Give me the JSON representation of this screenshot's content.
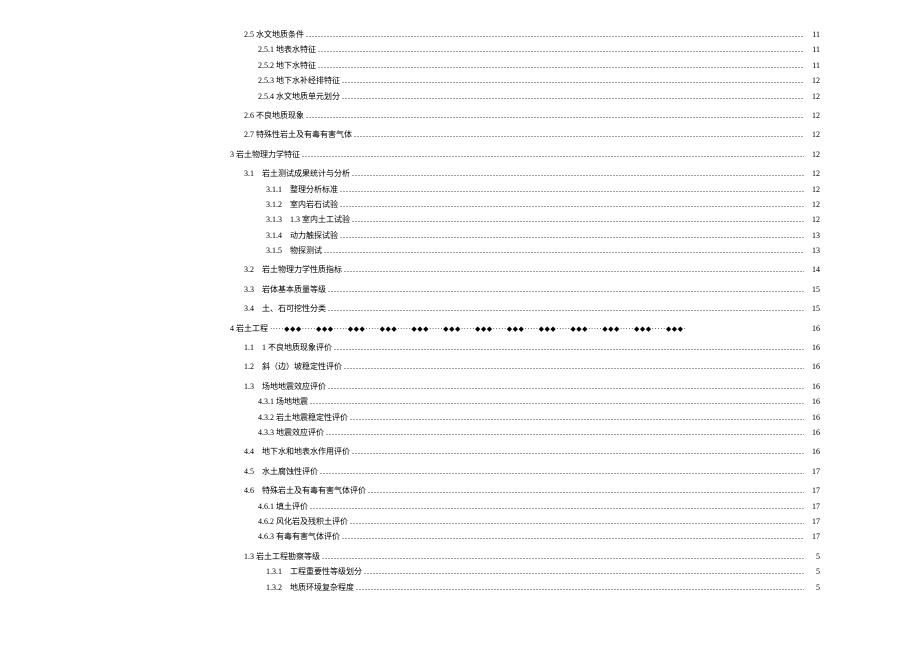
{
  "toc": [
    {
      "id": "r0",
      "level": "lvl-2",
      "label": "2.5 水文地质条件",
      "page": "11",
      "style": "dot"
    },
    {
      "id": "r1",
      "level": "lvl-3",
      "label": "2.5.1 地表水特征",
      "page": "11",
      "style": "dot"
    },
    {
      "id": "r2",
      "level": "lvl-3",
      "label": "2.5.2 地下水特征",
      "page": "11",
      "style": "dot"
    },
    {
      "id": "r3",
      "level": "lvl-3",
      "label": "2.5.3 地下水补经排特征",
      "page": "12",
      "style": "dot"
    },
    {
      "id": "r4",
      "level": "lvl-3",
      "label": "2.5.4 水文地质单元划分",
      "page": "12",
      "style": "dot"
    },
    {
      "id": "r5",
      "level": "lvl-2",
      "label": "2.6 不良地质现象",
      "page": "12",
      "style": "dot"
    },
    {
      "id": "r6",
      "level": "lvl-2",
      "label": "2.7 特殊性岩土及有毒有害气体",
      "page": "12",
      "style": "dot"
    },
    {
      "id": "r7",
      "level": "lvl-1",
      "label": "3 岩土物理力学特征",
      "page": "12",
      "style": "dot"
    },
    {
      "id": "r8",
      "level": "lvl-2",
      "label": "3.1　岩土测试成果统计与分析",
      "page": "12",
      "style": "dot"
    },
    {
      "id": "r9",
      "level": "lvl-3b",
      "label": "3.1.1　整理分析标准",
      "page": "12",
      "style": "dot"
    },
    {
      "id": "r10",
      "level": "lvl-3b",
      "label": "3.1.2　室内岩石试验",
      "page": "12",
      "style": "dot"
    },
    {
      "id": "r11",
      "level": "lvl-3b",
      "label": "3.1.3　1.3 室内土工试验",
      "page": "12",
      "style": "dot"
    },
    {
      "id": "r12",
      "level": "lvl-3b",
      "label": "3.1.4　动力触探试验",
      "page": "13",
      "style": "dot"
    },
    {
      "id": "r13",
      "level": "lvl-3b",
      "label": "3.1.5　物探测试",
      "page": "13",
      "style": "dot"
    },
    {
      "id": "r14",
      "level": "lvl-2",
      "label": "3.2　岩土物理力学性质指标",
      "page": "14",
      "style": "dot"
    },
    {
      "id": "r15",
      "level": "lvl-2",
      "label": "3.3　岩体基本质量等级",
      "page": "15",
      "style": "dot"
    },
    {
      "id": "r16",
      "level": "lvl-2",
      "label": "3.4　土、石可挖性分类",
      "page": "15",
      "style": "dot"
    },
    {
      "id": "r17",
      "level": "lvl-1",
      "label": "4 岩土工程 ",
      "page": "16",
      "style": "diamond"
    },
    {
      "id": "r18",
      "level": "lvl-2",
      "label": "1.1　1 不良地质现象评价",
      "page": "16",
      "style": "dot"
    },
    {
      "id": "r19",
      "level": "lvl-2",
      "label": "1.2　斜（边）坡稳定性评价",
      "page": "16",
      "style": "dot"
    },
    {
      "id": "r20",
      "level": "lvl-2",
      "label": "1.3　场地地震效应评价",
      "page": "16",
      "style": "dot"
    },
    {
      "id": "r21",
      "level": "lvl-3",
      "label": "4.3.1 场地地震",
      "page": "16",
      "style": "dot"
    },
    {
      "id": "r22",
      "level": "lvl-3",
      "label": "4.3.2 岩土地震稳定性评价",
      "page": "16",
      "style": "dot"
    },
    {
      "id": "r23",
      "level": "lvl-3",
      "label": "4.3.3 地震效应评价",
      "page": "16",
      "style": "dot"
    },
    {
      "id": "r24",
      "level": "lvl-2",
      "label": "4.4　地下水和地表水作用评价",
      "page": "16",
      "style": "dot"
    },
    {
      "id": "r25",
      "level": "lvl-2",
      "label": "4.5　水土腐蚀性评价",
      "page": "17",
      "style": "dot"
    },
    {
      "id": "r26",
      "level": "lvl-2",
      "label": "4.6　特殊岩土及有毒有害气体评价",
      "page": "17",
      "style": "dot"
    },
    {
      "id": "r27",
      "level": "lvl-3",
      "label": "4.6.1 填土评价",
      "page": "17",
      "style": "dot"
    },
    {
      "id": "r28",
      "level": "lvl-3",
      "label": "4.6.2 风化岩及残积土评价",
      "page": "17",
      "style": "dot"
    },
    {
      "id": "r29",
      "level": "lvl-3",
      "label": "4.6.3 有毒有害气体评价",
      "page": "17",
      "style": "dot"
    },
    {
      "id": "r30",
      "level": "lvl-2",
      "label": "1.3 岩土工程勘察等级",
      "page": "5",
      "style": "dot"
    },
    {
      "id": "r31",
      "level": "lvl-3b",
      "label": "1.3.1　工程重要性等级划分",
      "page": "5",
      "style": "dot"
    },
    {
      "id": "r32",
      "level": "lvl-3b",
      "label": "1.3.2　地质环境复杂程度",
      "page": "5",
      "style": "dot"
    }
  ]
}
